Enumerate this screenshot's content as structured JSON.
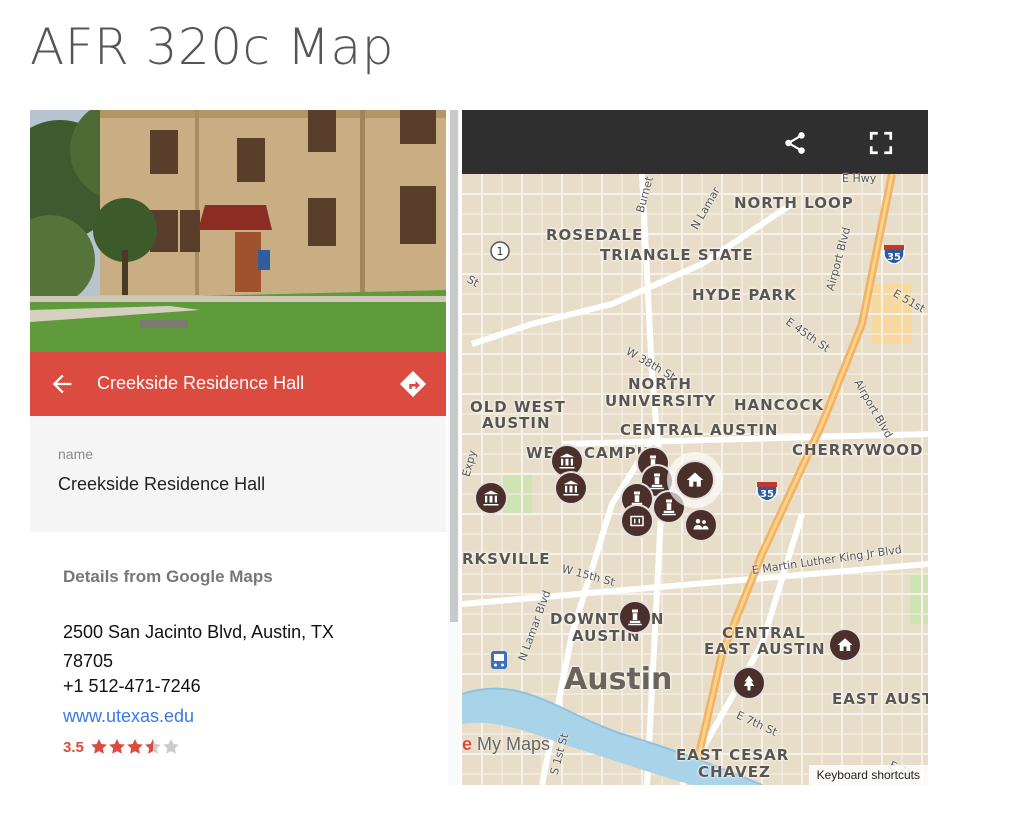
{
  "page": {
    "title": "AFR 320c Map"
  },
  "place": {
    "title": "Creekside Residence Hall",
    "name_label": "name",
    "name_value": "Creekside Residence Hall",
    "details_heading": "Details from Google Maps",
    "address_line1": "2500 San Jacinto Blvd, Austin, TX",
    "address_line2": "78705",
    "phone": "+1 512-471-7246",
    "website": "www.utexas.edu",
    "rating": "3.5",
    "rating_value": 3.5,
    "rating_max": 5
  },
  "colors": {
    "accent": "#db4b3f",
    "toolbar": "#2f2f2f",
    "marker": "#4a2f2a",
    "link": "#3b78e7",
    "star_off": "#cccccc"
  },
  "map": {
    "icons": {
      "share": "share-icon",
      "fullscreen": "fullscreen-icon",
      "back": "arrow-left-icon",
      "directions": "directions-icon"
    },
    "neighborhoods": {
      "north_loop": "NORTH LOOP",
      "rosedale": "ROSEDALE",
      "triangle_state": "TRIANGLE STATE",
      "hyde_park": "HYDE PARK",
      "north_university_1": "NORTH",
      "north_university_2": "UNIVERSITY",
      "hancock": "HANCOCK",
      "old_west_austin_1": "OLD WEST",
      "old_west_austin_2": "AUSTIN",
      "central_austin": "CENTRAL AUSTIN",
      "cherrywood": "CHERRYWOOD",
      "west_campus": "WEST CAMPUS",
      "clarksville": "RKSVILLE",
      "downtown_1": "DOWNTOWN",
      "downtown_2": "AUSTIN",
      "central_east_austin_1": "CENTRAL",
      "central_east_austin_2": "EAST AUSTIN",
      "east_austin": "EAST AUST",
      "east_cesar_chavez_1": "EAST CESAR",
      "east_cesar_chavez_2": "CHAVEZ",
      "city": "Austin"
    },
    "streets": {
      "w_38th": "W 38th St",
      "e_45th": "E 45th St",
      "e_51st": "E 51st",
      "airport_blvd": "Airport Blvd",
      "airport_blvd_2": "Airport Blvd",
      "n_lamar": "N Lamar",
      "n_lamar_blvd": "N Lamar Blvd",
      "burnet": "Burnet",
      "w_15th": "W 15th St",
      "mlk": "E Martin Luther King Jr Blvd",
      "e_7th": "E 7th St",
      "e_7th_2": "E 7th",
      "s_1st": "S 1st St",
      "expy": "Expy",
      "st": "St",
      "e_hwy": "E Hwy"
    },
    "shields": {
      "tx1": "1",
      "i35_north": "35",
      "i35_central": "35"
    },
    "markers": [
      {
        "name": "museum",
        "icon": "museum-icon"
      },
      {
        "name": "museum",
        "icon": "museum-icon"
      },
      {
        "name": "museum",
        "icon": "museum-icon"
      },
      {
        "name": "monument",
        "icon": "monument-icon"
      },
      {
        "name": "monument",
        "icon": "monument-icon"
      },
      {
        "name": "monument",
        "icon": "monument-icon"
      },
      {
        "name": "monument",
        "icon": "monument-icon"
      },
      {
        "name": "stadium",
        "icon": "stadium-icon"
      },
      {
        "name": "home",
        "icon": "home-icon"
      },
      {
        "name": "community",
        "icon": "people-icon"
      },
      {
        "name": "monument",
        "icon": "monument-icon"
      },
      {
        "name": "home",
        "icon": "home-icon"
      },
      {
        "name": "park",
        "icon": "tree-icon"
      }
    ],
    "logo": "My Maps",
    "keyboard_shortcuts": "Keyboard shortcuts"
  }
}
